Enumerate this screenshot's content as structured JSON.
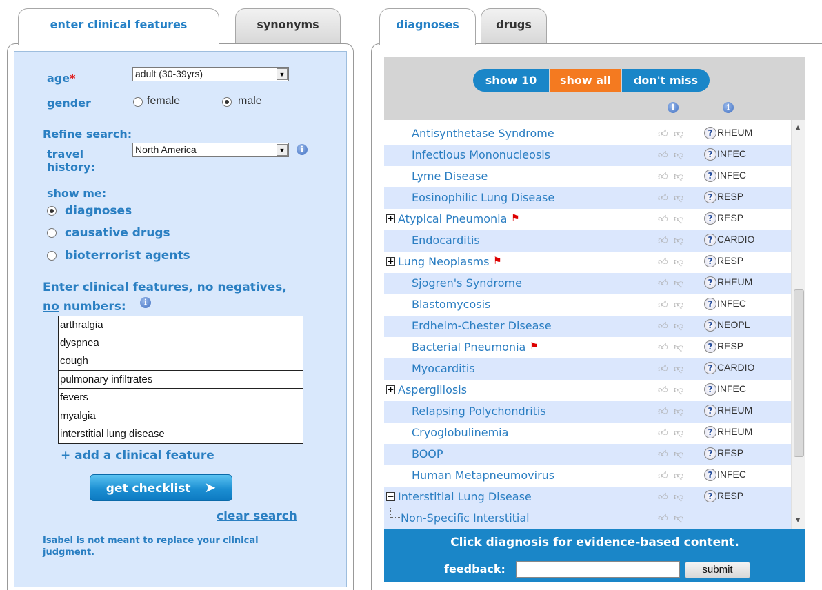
{
  "left_tabs": {
    "active": "enter clinical features",
    "inactive": "synonyms"
  },
  "right_tabs": {
    "active": "diagnoses",
    "inactive": "drugs"
  },
  "form": {
    "age_label": "age",
    "required_mark": "*",
    "age_value": "adult (30-39yrs)",
    "gender_label": "gender",
    "gender_options": [
      "female",
      "male"
    ],
    "gender_selected": "male",
    "refine_label": "Refine search:",
    "travel_label": "travel history:",
    "travel_value": "North America",
    "show_me_label": "show me:",
    "show_options": [
      "diagnoses",
      "causative drugs",
      "bioterrorist agents"
    ],
    "show_selected": "diagnoses",
    "enter_prefix": "Enter clinical features, ",
    "enter_no1": "no",
    "enter_mid": " negatives,",
    "enter_no2": "no",
    "enter_suffix": " numbers:",
    "features": [
      "arthralgia",
      "dyspnea",
      "cough",
      "pulmonary infiltrates",
      "fevers",
      "myalgia",
      "interstitial lung disease"
    ],
    "add_feature": "+ add a clinical feature",
    "get_checklist": "get checklist",
    "clear_search": "clear search",
    "disclaimer": "Isabel is not meant to replace your clinical judgment."
  },
  "results": {
    "filters": [
      "show 10",
      "show all",
      "don't miss"
    ],
    "active_filter": "show all",
    "rows": [
      {
        "name": "Antisynthetase Syndrome",
        "spec": "RHEUM",
        "expand": "",
        "flag": false
      },
      {
        "name": "Infectious Mononucleosis",
        "spec": "INFEC",
        "expand": "",
        "flag": false
      },
      {
        "name": "Lyme Disease",
        "spec": "INFEC",
        "expand": "",
        "flag": false
      },
      {
        "name": "Eosinophilic Lung Disease",
        "spec": "RESP",
        "expand": "",
        "flag": false
      },
      {
        "name": "Atypical Pneumonia",
        "spec": "RESP",
        "expand": "+",
        "flag": true
      },
      {
        "name": "Endocarditis",
        "spec": "CARDIO",
        "expand": "",
        "flag": false
      },
      {
        "name": "Lung Neoplasms",
        "spec": "RESP",
        "expand": "+",
        "flag": true
      },
      {
        "name": "Sjogren's Syndrome",
        "spec": "RHEUM",
        "expand": "",
        "flag": false
      },
      {
        "name": "Blastomycosis",
        "spec": "INFEC",
        "expand": "",
        "flag": false
      },
      {
        "name": "Erdheim-Chester Disease",
        "spec": "NEOPL",
        "expand": "",
        "flag": false
      },
      {
        "name": "Bacterial Pneumonia",
        "spec": "RESP",
        "expand": "",
        "flag": true
      },
      {
        "name": "Myocarditis",
        "spec": "CARDIO",
        "expand": "",
        "flag": false
      },
      {
        "name": "Aspergillosis",
        "spec": "INFEC",
        "expand": "+",
        "flag": false
      },
      {
        "name": "Relapsing Polychondritis",
        "spec": "RHEUM",
        "expand": "",
        "flag": false
      },
      {
        "name": "Cryoglobulinemia",
        "spec": "RHEUM",
        "expand": "",
        "flag": false
      },
      {
        "name": "BOOP",
        "spec": "RESP",
        "expand": "",
        "flag": false
      },
      {
        "name": "Human Metapneumovirus",
        "spec": "INFEC",
        "expand": "",
        "flag": false
      },
      {
        "name": "Interstitial Lung Disease",
        "spec": "RESP",
        "expand": "−",
        "flag": false
      }
    ],
    "subrow": "Non-Specific Interstitial",
    "footer_text": "Click diagnosis for evidence-based content.",
    "feedback_label": "feedback:",
    "feedback_value": "",
    "submit_label": "submit"
  },
  "colors": {
    "accent": "#2a7fc2",
    "orange": "#f47a20",
    "footer": "#1a86c8",
    "panel_bg": "#d9e8fc"
  },
  "icons": [
    "info-icon",
    "question-icon",
    "thumb-up-icon",
    "thumb-down-icon",
    "red-flag-icon",
    "dropdown-arrow-icon",
    "chevron-right-icon",
    "expand-plus-icon",
    "collapse-minus-icon"
  ]
}
